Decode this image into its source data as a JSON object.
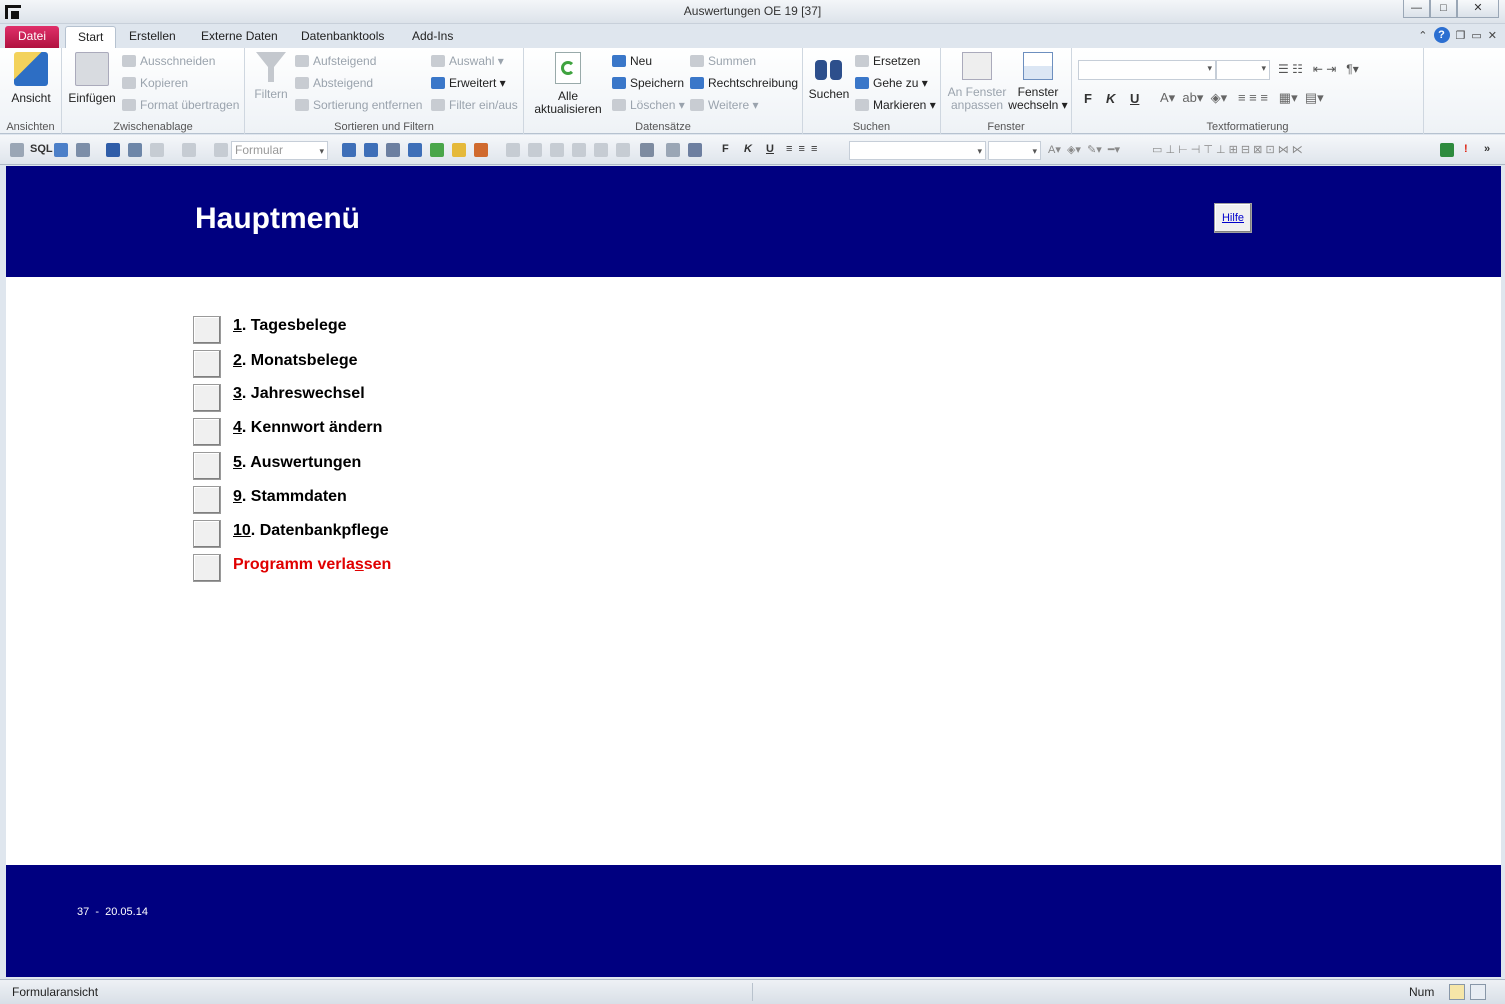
{
  "window": {
    "title": "Auswertungen OE 19 [37]",
    "min": "—",
    "max": "□",
    "close": "✕"
  },
  "tabs": [
    {
      "label": "Datei"
    },
    {
      "label": "Start"
    },
    {
      "label": "Erstellen"
    },
    {
      "label": "Externe Daten"
    },
    {
      "label": "Datenbanktools"
    },
    {
      "label": "Add-Ins"
    }
  ],
  "ribbon": {
    "ansichten": {
      "label": "Ansichten",
      "ansicht": "Ansicht"
    },
    "zwischenablage": {
      "label": "Zwischenablage",
      "einfuegen": "Einfügen",
      "ausschneiden": "Ausschneiden",
      "kopieren": "Kopieren",
      "format": "Format übertragen"
    },
    "sortieren": {
      "label": "Sortieren und Filtern",
      "filtern": "Filtern",
      "aufsteigend": "Aufsteigend",
      "absteigend": "Absteigend",
      "sortierung": "Sortierung entfernen",
      "auswahl": "Auswahl",
      "erweitert": "Erweitert",
      "filter": "Filter ein/aus"
    },
    "datensaetze": {
      "label": "Datensätze",
      "alle1": "Alle",
      "alle2": "aktualisieren",
      "neu": "Neu",
      "speichern": "Speichern",
      "loeschen": "Löschen",
      "summen": "Summen",
      "recht": "Rechtschreibung",
      "weitere": "Weitere"
    },
    "suchen": {
      "label": "Suchen",
      "suchen": "Suchen",
      "ersetzen": "Ersetzen",
      "gehezu": "Gehe zu",
      "markieren": "Markieren"
    },
    "fenster": {
      "label": "Fenster",
      "anpassen1": "An Fenster",
      "anpassen2": "anpassen",
      "wechseln1": "Fenster",
      "wechseln2": "wechseln"
    },
    "text": {
      "label": "Textformatierung",
      "bold": "F",
      "italic": "K",
      "underline": "U"
    }
  },
  "toolbar": {
    "sql": "SQL",
    "combo": "Formular",
    "bold": "F",
    "italic": "K",
    "underline": "U"
  },
  "form": {
    "title": "Hauptmenü",
    "help": "Hilfe",
    "menu": [
      {
        "key": "1",
        "rest": ". Tagesbelege"
      },
      {
        "key": "2",
        "rest": ". Monatsbelege"
      },
      {
        "key": "3",
        "rest": ". Jahreswechsel"
      },
      {
        "key": "4",
        "rest": ". Kennwort ändern"
      },
      {
        "key": "5",
        "rest": ". Auswertungen"
      },
      {
        "key": "9",
        "rest": ". Stammdaten"
      },
      {
        "key": "10",
        "rest": ". Datenbankpflege"
      }
    ],
    "exit": {
      "pre": "Programm verla",
      "key": "s",
      "post": "sen"
    },
    "footer": "37  -  20.05.14"
  },
  "status": {
    "left": "Formularansicht",
    "num": "Num"
  },
  "colors": {
    "header": "#000080",
    "exit": "#e00000",
    "file_tab": "#c4184f"
  }
}
